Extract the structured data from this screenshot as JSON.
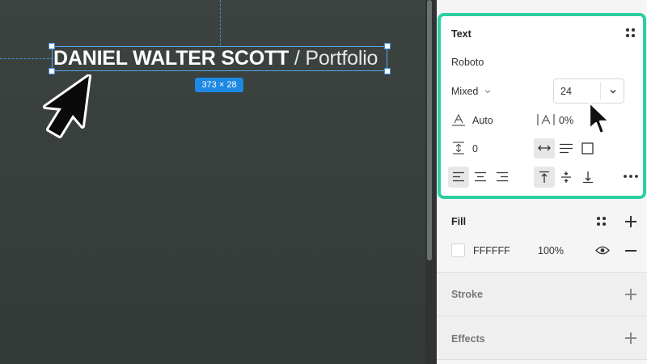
{
  "canvas": {
    "title_bold": "DANIEL WALTER SCOTT",
    "title_light": "/ Portfolio",
    "dimensions": "373 × 28"
  },
  "panel": {
    "text_section": {
      "title": "Text",
      "font_family": "Roboto",
      "font_weight": "Mixed",
      "font_size": "24",
      "line_height": "Auto",
      "letter_spacing": "0%",
      "paragraph_spacing": "0"
    },
    "fill": {
      "title": "Fill",
      "color_hex": "FFFFFF",
      "opacity": "100%"
    },
    "stroke": {
      "title": "Stroke"
    },
    "effects": {
      "title": "Effects"
    }
  },
  "colors": {
    "canvas_bg": "#3a403d",
    "selection_blue": "#1e88e5",
    "highlight_teal": "#2ccfa2",
    "panel_bg": "#f5f5f5"
  },
  "icons": [
    "four-dots-icon",
    "chevron-down-icon",
    "line-height-icon",
    "letter-spacing-icon",
    "paragraph-spacing-icon",
    "auto-width-icon",
    "auto-height-icon",
    "fixed-size-icon",
    "align-left-icon",
    "align-center-icon",
    "align-right-icon",
    "align-top-icon",
    "align-middle-icon",
    "align-bottom-icon",
    "more-options-icon",
    "eye-icon",
    "plus-icon",
    "minus-icon",
    "cursor-icon"
  ]
}
